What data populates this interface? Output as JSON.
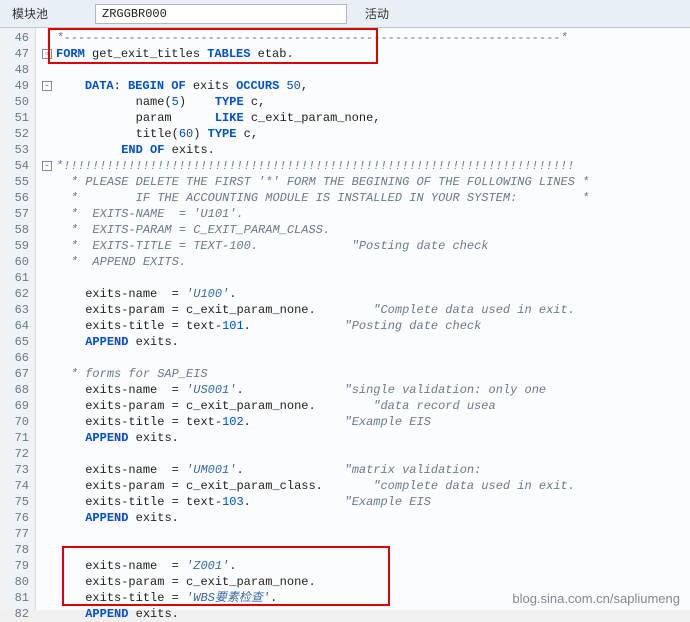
{
  "header": {
    "label": "模块池",
    "value": "ZRGGBR000",
    "status": "活动"
  },
  "lines": {
    "46": {
      "type": "cmt",
      "text": "*---------------------------------------------------------------------*"
    },
    "47": {
      "fold": "▢",
      "type": "form",
      "kw1": "FORM",
      "id": " get_exit_titles ",
      "kw2": "TABLES",
      "tail": " etab."
    },
    "48": {
      "type": "blank"
    },
    "49": {
      "fold": "-",
      "type": "data",
      "pre": "    ",
      "kw1": "DATA",
      "mid": ": ",
      "kw2": "BEGIN OF",
      "id": " exits ",
      "kw3": "OCCURS",
      "num": " 50",
      "tail": ","
    },
    "50": {
      "type": "raw",
      "pre": "           ",
      "f": "name",
      "par": "(",
      "n": "5",
      "par2": ")    ",
      "kw": "TYPE",
      "t": " c,"
    },
    "51": {
      "type": "raw",
      "pre": "           ",
      "f": "param      ",
      "kw": "LIKE",
      "t": " c_exit_param_none,"
    },
    "52": {
      "type": "raw",
      "pre": "           ",
      "f": "title",
      "par": "(",
      "n": "60",
      "par2": ") ",
      "kw": "TYPE",
      "t": " c,"
    },
    "53": {
      "type": "endof",
      "pre": "         ",
      "kw": "END OF",
      "tail": " exits."
    },
    "54": {
      "fold": "-",
      "type": "cmt",
      "text": "*!!!!!!!!!!!!!!!!!!!!!!!!!!!!!!!!!!!!!!!!!!!!!!!!!!!!!!!!!!!!!!!!!!!!!!!"
    },
    "55": {
      "type": "cmt",
      "text": "  * PLEASE DELETE THE FIRST '*' FORM THE BEGINING OF THE FOLLOWING LINES *"
    },
    "56": {
      "type": "cmt",
      "text": "  *        IF THE ACCOUNTING MODULE IS INSTALLED IN YOUR SYSTEM:         *"
    },
    "57": {
      "type": "cmt",
      "text": "  *  EXITS-NAME  = 'U101'."
    },
    "58": {
      "type": "cmt",
      "text": "  *  EXITS-PARAM = C_EXIT_PARAM_CLASS."
    },
    "59": {
      "type": "cmt",
      "text": "  *  EXITS-TITLE = TEXT-100.             \"Posting date check"
    },
    "60": {
      "type": "cmt",
      "text": "  *  APPEND EXITS."
    },
    "61": {
      "type": "blank"
    },
    "62": {
      "type": "assign",
      "pre": "    ",
      "l": "exits-name  ",
      "op": "=",
      "sp": " ",
      "str": "'U100'",
      "tail": ".",
      "cmt": ""
    },
    "63": {
      "type": "assign",
      "pre": "    ",
      "l": "exits-param ",
      "op": "=",
      "sp": " ",
      "rhs": "c_exit_param_none.",
      "cmt": "        \"Complete data used in exit."
    },
    "64": {
      "type": "assign",
      "pre": "    ",
      "l": "exits-title ",
      "op": "=",
      "sp": " ",
      "rhs": "text",
      "dash": "-",
      "num": "101",
      "tail": ".",
      "cmt": "             \"Posting date check"
    },
    "65": {
      "type": "append",
      "pre": "    ",
      "kw": "APPEND",
      "tail": " exits."
    },
    "66": {
      "type": "blank"
    },
    "67": {
      "type": "cmt",
      "text": "  * forms for SAP_EIS"
    },
    "68": {
      "type": "assign",
      "pre": "    ",
      "l": "exits-name  ",
      "op": "=",
      "sp": " ",
      "str": "'US001'",
      "tail": ".",
      "cmt": "              \"single validation: only one"
    },
    "69": {
      "type": "assign",
      "pre": "    ",
      "l": "exits-param ",
      "op": "=",
      "sp": " ",
      "rhs": "c_exit_param_none.",
      "cmt": "        \"data record usea"
    },
    "70": {
      "type": "assign",
      "pre": "    ",
      "l": "exits-title ",
      "op": "=",
      "sp": " ",
      "rhs": "text",
      "dash": "-",
      "num": "102",
      "tail": ".",
      "cmt": "             \"Example EIS"
    },
    "71": {
      "type": "append",
      "pre": "    ",
      "kw": "APPEND",
      "tail": " exits."
    },
    "72": {
      "type": "blank"
    },
    "73": {
      "type": "assign",
      "pre": "    ",
      "l": "exits-name  ",
      "op": "=",
      "sp": " ",
      "str": "'UM001'",
      "tail": ".",
      "cmt": "              \"matrix validation:"
    },
    "74": {
      "type": "assign",
      "pre": "    ",
      "l": "exits-param ",
      "op": "=",
      "sp": " ",
      "rhs": "c_exit_param_class.",
      "cmt": "       \"complete data used in exit."
    },
    "75": {
      "type": "assign",
      "pre": "    ",
      "l": "exits-title ",
      "op": "=",
      "sp": " ",
      "rhs": "text",
      "dash": "-",
      "num": "103",
      "tail": ".",
      "cmt": "             \"Example EIS"
    },
    "76": {
      "type": "append",
      "pre": "    ",
      "kw": "APPEND",
      "tail": " exits."
    },
    "77": {
      "type": "blank"
    },
    "78": {
      "type": "blank"
    },
    "79": {
      "type": "assign",
      "pre": "    ",
      "l": "exits-name  ",
      "op": "=",
      "sp": " ",
      "str": "'Z001'",
      "tail": ".",
      "cmt": ""
    },
    "80": {
      "type": "assign",
      "pre": "    ",
      "l": "exits-param ",
      "op": "=",
      "sp": " ",
      "rhs": "c_exit_param_none.",
      "cmt": ""
    },
    "81": {
      "type": "assign",
      "pre": "    ",
      "l": "exits-title ",
      "op": "=",
      "sp": " ",
      "str": "'WBS要素检查'",
      "tail": ".",
      "cmt": ""
    },
    "82": {
      "type": "append",
      "pre": "    ",
      "kw": "APPEND",
      "tail": " exits."
    }
  },
  "line_numbers": [
    "46",
    "47",
    "48",
    "49",
    "50",
    "51",
    "52",
    "53",
    "54",
    "55",
    "56",
    "57",
    "58",
    "59",
    "60",
    "61",
    "62",
    "63",
    "64",
    "65",
    "66",
    "67",
    "68",
    "69",
    "70",
    "71",
    "72",
    "73",
    "74",
    "75",
    "76",
    "77",
    "78",
    "79",
    "80",
    "81",
    "82"
  ],
  "watermark": "blog.sina.com.cn/sapliumeng"
}
